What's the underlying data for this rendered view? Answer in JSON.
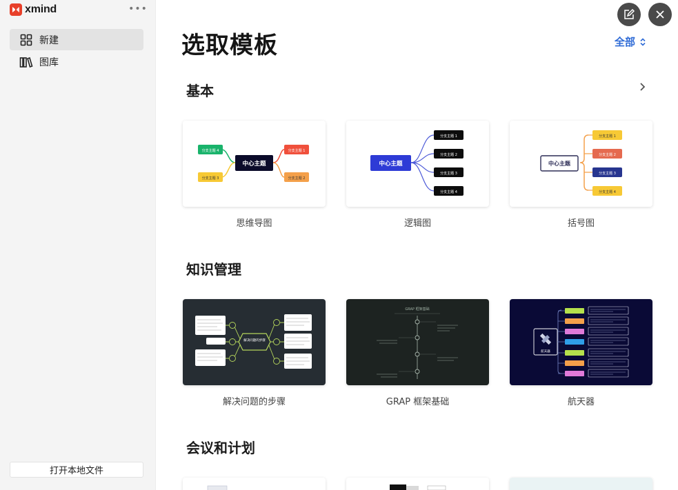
{
  "app": {
    "name": "xmind",
    "more_label": "•••"
  },
  "sidebar": {
    "items": [
      {
        "label": "新建",
        "icon": "grid-icon",
        "active": true
      },
      {
        "label": "图库",
        "icon": "library-icon",
        "active": false
      }
    ],
    "open_local_label": "打开本地文件"
  },
  "main": {
    "title": "选取模板",
    "filter_label": "全部",
    "sections": [
      {
        "title": "基本",
        "cards": [
          {
            "label": "思维导图",
            "center": "中心主题",
            "branches": [
              "分支主题 4",
              "分支主题 1",
              "分支主题 3",
              "分支主题 2"
            ]
          },
          {
            "label": "逻辑图",
            "center": "中心主题",
            "branches": [
              "分支主题 1",
              "分支主题 2",
              "分支主题 3",
              "分支主题 4"
            ]
          },
          {
            "label": "括号图",
            "center": "中心主题",
            "branches": [
              "分支主题 1",
              "分支主题 2",
              "分支主题 3",
              "分支主题 4"
            ]
          }
        ]
      },
      {
        "title": "知识管理",
        "cards": [
          {
            "label": "解决问题的步骤",
            "center": "解决问题的步骤"
          },
          {
            "label": "GRAP 框架基础",
            "center": "GRAP 框架基础"
          },
          {
            "label": "航天器",
            "center": "航天器"
          }
        ]
      },
      {
        "title": "会议和计划",
        "cards": []
      }
    ]
  },
  "colors": {
    "accent": "#2f6bd6",
    "green": "#19b36b",
    "red": "#f0503c",
    "yellow": "#f7c935",
    "orange": "#f4a04a",
    "dark_node": "#0b0b2a",
    "blue_node": "#2e3bd6"
  }
}
